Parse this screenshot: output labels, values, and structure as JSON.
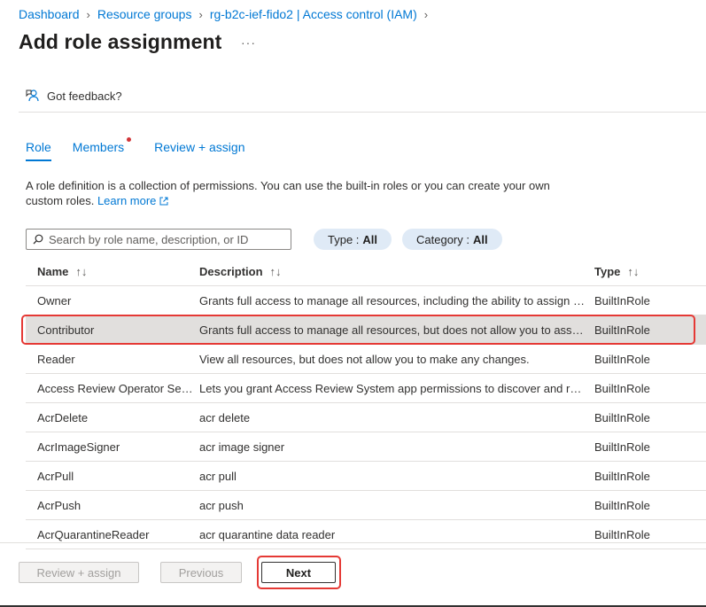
{
  "breadcrumb": [
    {
      "label": "Dashboard"
    },
    {
      "label": "Resource groups"
    },
    {
      "label": "rg-b2c-ief-fido2 | Access control (IAM)"
    }
  ],
  "page": {
    "title": "Add role assignment",
    "more": "···"
  },
  "feedback": {
    "label": "Got feedback?",
    "icon": "feedback-icon"
  },
  "tabs": [
    {
      "label": "Role",
      "active": true
    },
    {
      "label": "Members",
      "has_indicator": true
    },
    {
      "label": "Review + assign"
    }
  ],
  "description": {
    "text": "A role definition is a collection of permissions. You can use the built-in roles or you can create your own custom roles.",
    "learn_more": "Learn more"
  },
  "search": {
    "placeholder": "Search by role name, description, or ID",
    "value": ""
  },
  "filters": [
    {
      "label": "Type :",
      "value": "All"
    },
    {
      "label": "Category :",
      "value": "All"
    }
  ],
  "table": {
    "columns": [
      "Name",
      "Description",
      "Type"
    ],
    "sort_glyph": "↑↓",
    "rows": [
      {
        "name": "Owner",
        "description": "Grants full access to manage all resources, including the ability to assign r...",
        "type": "BuiltInRole"
      },
      {
        "name": "Contributor",
        "description": "Grants full access to manage all resources, but does not allow you to assig...",
        "type": "BuiltInRole",
        "selected": true
      },
      {
        "name": "Reader",
        "description": "View all resources, but does not allow you to make any changes.",
        "type": "BuiltInRole"
      },
      {
        "name": "Access Review Operator Serv...",
        "description": "Lets you grant Access Review System app permissions to discover and rev...",
        "type": "BuiltInRole"
      },
      {
        "name": "AcrDelete",
        "description": "acr delete",
        "type": "BuiltInRole"
      },
      {
        "name": "AcrImageSigner",
        "description": "acr image signer",
        "type": "BuiltInRole"
      },
      {
        "name": "AcrPull",
        "description": "acr pull",
        "type": "BuiltInRole"
      },
      {
        "name": "AcrPush",
        "description": "acr push",
        "type": "BuiltInRole"
      },
      {
        "name": "AcrQuarantineReader",
        "description": "acr quarantine data reader",
        "type": "BuiltInRole"
      }
    ]
  },
  "footer": {
    "review_assign": "Review + assign",
    "previous": "Previous",
    "next": "Next"
  },
  "colors": {
    "accent": "#0078d4",
    "highlight": "#e53935",
    "indicator": "#d13438"
  }
}
